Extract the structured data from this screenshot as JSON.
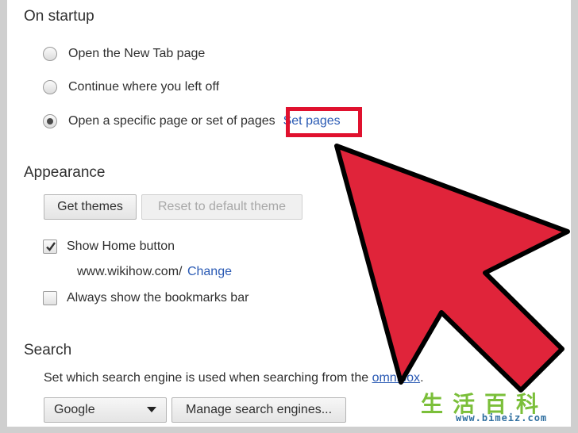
{
  "startup": {
    "title": "On startup",
    "options": [
      {
        "label": "Open the New Tab page",
        "checked": false
      },
      {
        "label": "Continue where you left off",
        "checked": false
      },
      {
        "label": "Open a specific page or set of pages",
        "checked": true
      }
    ],
    "set_pages_link": "Set pages"
  },
  "appearance": {
    "title": "Appearance",
    "get_themes_label": "Get themes",
    "reset_theme_label": "Reset to default theme",
    "show_home_label": "Show Home button",
    "home_url": "www.wikihow.com/",
    "change_link": "Change",
    "bookmarks_label": "Always show the bookmarks bar"
  },
  "search": {
    "title": "Search",
    "description_prefix": "Set which search engine is used when searching from the",
    "omnibox_link": "omnibox",
    "description_suffix": ".",
    "engine_selected": "Google",
    "manage_label": "Manage search engines..."
  },
  "watermark": {
    "chars": "生活百科",
    "url": "www.bimeiz.com"
  },
  "colors": {
    "arrow_fill": "#e0243a",
    "arrow_stroke": "#000000",
    "highlight": "#e0112e",
    "link": "#2a5ab4"
  }
}
